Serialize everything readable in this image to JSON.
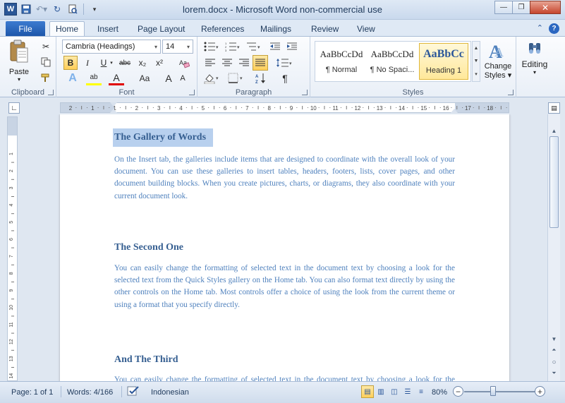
{
  "window": {
    "title": "lorem.docx  -  Microsoft Word non-commercial use",
    "app_icon_letter": "W",
    "minimize": "—",
    "restore": "❐",
    "close": "✕"
  },
  "tabs": {
    "file": "File",
    "items": [
      "Home",
      "Insert",
      "Page Layout",
      "References",
      "Mailings",
      "Review",
      "View"
    ],
    "active": "Home"
  },
  "ribbon": {
    "clipboard": {
      "label": "Clipboard",
      "paste": "Paste"
    },
    "font": {
      "label": "Font",
      "font_name": "Cambria (Headings)",
      "font_size": "14",
      "bold": "B",
      "italic": "I",
      "underline": "U",
      "strikethrough": "abc",
      "subscript": "x₂",
      "superscript": "x²",
      "font_color_letter": "A",
      "change_case": "Aa",
      "grow": "A",
      "shrink": "A",
      "highlight": "ab"
    },
    "paragraph": {
      "label": "Paragraph",
      "show_marks": "¶"
    },
    "styles": {
      "label": "Styles",
      "items": [
        {
          "sample": "AaBbCcDd",
          "name": "¶ Normal"
        },
        {
          "sample": "AaBbCcDd",
          "name": "¶ No Spaci..."
        },
        {
          "sample": "AaBbCc",
          "name": "Heading 1"
        }
      ],
      "change_styles": "Change Styles",
      "change_styles_line1": "Change",
      "change_styles_line2": "Styles ▾"
    },
    "editing": {
      "label": "Editing"
    }
  },
  "document": {
    "sections": [
      {
        "heading": "The Gallery of Words",
        "body": "On the Insert tab, the galleries include items that are designed to coordinate with the overall look of your document. You can use these galleries to insert tables, headers, footers, lists, cover pages, and other document building blocks. When you create pictures, charts, or diagrams, they also coordinate with your current document look."
      },
      {
        "heading": "The Second One",
        "body": "You can easily change the formatting of selected text in the document text by choosing a look for the selected text from the Quick Styles gallery on the Home tab. You can also format text directly by using the other controls on the Home tab. Most controls offer a choice of using the look from the current theme or using a format that you specify directly."
      },
      {
        "heading": "And The Third",
        "body": "You can easily change the formatting of selected text in the document text by choosing a look for the selected text from the Quick Styles gallery on the Home tab."
      }
    ]
  },
  "ruler": {
    "h_ticks": [
      "2",
      "1",
      "1",
      "2",
      "3",
      "4",
      "5",
      "6",
      "7",
      "8",
      "9",
      "10",
      "11",
      "12",
      "13",
      "14",
      "15",
      "16",
      "17",
      "18"
    ],
    "v_ticks": [
      "1",
      "2",
      "3",
      "4",
      "5",
      "6",
      "7",
      "8",
      "9",
      "10",
      "11",
      "12",
      "13",
      "14"
    ]
  },
  "statusbar": {
    "page": "Page: 1 of 1",
    "words": "Words: 4/166",
    "language": "Indonesian",
    "zoom": "80%",
    "zoom_level": 0.8,
    "zoom_minus": "−",
    "zoom_plus": "+"
  },
  "colors": {
    "heading": "#365f91",
    "body": "#4f81bd",
    "selection": "#b8d0ee",
    "accent": "#2b5797"
  }
}
